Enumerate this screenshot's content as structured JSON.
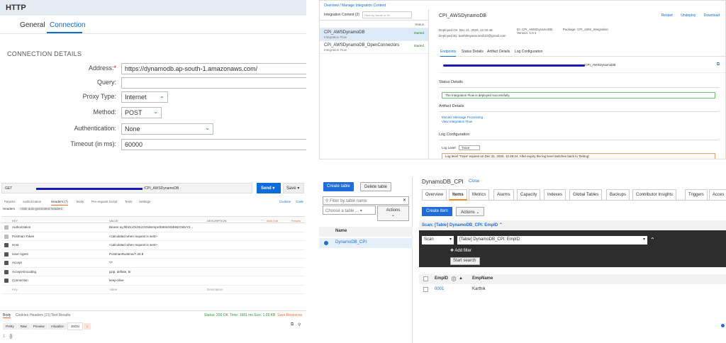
{
  "http_panel": {
    "header": "HTTP",
    "tabs": [
      "General",
      "Connection"
    ],
    "section_title": "CONNECTION DETAILS",
    "fields": [
      {
        "label": "Address:",
        "required": true,
        "value": "https://dynamodb.ap-south-1.amazonaws.com/",
        "kind": "input"
      },
      {
        "label": "Query:",
        "required": false,
        "value": "",
        "kind": "input"
      },
      {
        "label": "Proxy Type:",
        "required": false,
        "value": "Internet",
        "kind": "select"
      },
      {
        "label": "Method:",
        "required": false,
        "value": "POST",
        "kind": "select"
      },
      {
        "label": "Authentication:",
        "required": false,
        "value": "None",
        "kind": "select"
      },
      {
        "label": "Timeout (in ms):",
        "required": false,
        "value": "60000",
        "kind": "input"
      }
    ]
  },
  "integration_panel": {
    "breadcrumb": "Overview / Manage Integration Content",
    "left_title": "Integration Content (2)",
    "search_placeholder": "Filter by Name or ID",
    "col_status": "Status",
    "items": [
      {
        "name": "CPI_AWSDynamoDB",
        "type": "Integration Flow",
        "status": "Started",
        "selected": true
      },
      {
        "name": "CPI_AWSDynamoDB_OpenConnectors",
        "type": "Integration Flow",
        "status": "Started",
        "selected": false
      }
    ],
    "title": "CPI_AWSDynamoDB",
    "actions": [
      "Restart",
      "Undeploy",
      "Download"
    ],
    "deployed_on": "Deployed On: Dec 31, 2020, 12:32:45",
    "deployed_by": "Deployed By: karthikeyansuresh10@gmail.com",
    "id": "ID: CPI_AWSDynamoDB",
    "version": "Version: 1.0.1",
    "package": "Package: CPI_AWS_Integration",
    "tabs": [
      "Endpoints",
      "Status Details",
      "Artifact Details",
      "Log Configuration"
    ],
    "endpoint_suffix": "/CPI_AWSDynamoDB",
    "status_details_title": "Status Details",
    "status_message": "The Integration Flow is deployed successfully.",
    "artifact_details_title": "Artifact Details",
    "links": [
      "Monitor Message Processing",
      "View Integration Flow"
    ],
    "log_config_title": "Log Configuration",
    "log_level_label": "Log Level:",
    "log_level_value": "Trace",
    "log_warning": "Log level 'Trace' expires on Dec 31, 2020, 12:48:24. After expiry the log level switches back to 'Debug'."
  },
  "postman_panel": {
    "method": "GET",
    "url_suffix": "/CPI_AWSDynamoDB",
    "send": "Send",
    "save": "Save",
    "tabs": [
      "Params",
      "Authorization",
      "Headers (7)",
      "Body",
      "Pre-request Script",
      "Tests",
      "Settings"
    ],
    "cookies_link": "Cookies",
    "code_link": "Code",
    "headers_label": "Headers",
    "hide_auto": "Hide auto-generated headers",
    "columns": [
      "KEY",
      "VALUE",
      "DESCRIPTION"
    ],
    "bulk_edit": "Bulk Edit",
    "presets": "Presets",
    "rows": [
      {
        "key": "Authorization",
        "value": "Bearer eyJhbGciOiJSUzI1NiIsImprdSI6Imh0dHBzOi8vY2...",
        "checked": "light"
      },
      {
        "key": "Postman-Token",
        "value": "<calculated when request is sent>",
        "checked": "light"
      },
      {
        "key": "Host",
        "value": "<calculated when request is sent>",
        "checked": "dark"
      },
      {
        "key": "User-Agent",
        "value": "PostmanRuntime/7.26.8",
        "checked": "dark"
      },
      {
        "key": "Accept",
        "value": "*/*",
        "checked": "dark"
      },
      {
        "key": "Accept-Encoding",
        "value": "gzip, deflate, br",
        "checked": "dark"
      },
      {
        "key": "Connection",
        "value": "keep-alive",
        "checked": "dark"
      },
      {
        "key": "Key",
        "value": "Value",
        "checked": "none",
        "placeholder": "Description"
      }
    ],
    "response_tabs": [
      "Body",
      "Cookies",
      "Headers (21)",
      "Test Results"
    ],
    "status": "Status: 200 OK",
    "time": "Time: 1681 ms",
    "size": "Size: 1.05 KB",
    "save_response": "Save Response",
    "formats": [
      "Pretty",
      "Raw",
      "Preview",
      "Visualize",
      "JSON"
    ],
    "body": "{}"
  },
  "dynamo_panel": {
    "create_table": "Create table",
    "delete_table": "Delete table",
    "filter_placeholder": "Filter by table name",
    "choose_table": "Choose a table ...",
    "actions": "Actions",
    "name_col": "Name",
    "tables": [
      "DynamoDB_CPI"
    ],
    "title": "DynamoDB_CPI",
    "close": "Close",
    "tabs": [
      "Overview",
      "Items",
      "Metrics",
      "Alarms",
      "Capacity",
      "Indexes",
      "Global Tables",
      "Backups",
      "Contributor Insights",
      "Triggers",
      "Acces"
    ],
    "create_item": "Create item",
    "actions2": "Actions",
    "scan_title": "Scan: [Table] DynamoDB_CPI: EmpID",
    "scan_mode": "Scan",
    "scan_target": "[Table] DynamoDB_CPI: EmpID",
    "add_filter": "Add filter",
    "start_search": "Start search",
    "columns": [
      "EmpID",
      "EmpName"
    ],
    "rows": [
      {
        "EmpID": "0001",
        "EmpName": "Karthik"
      }
    ]
  }
}
